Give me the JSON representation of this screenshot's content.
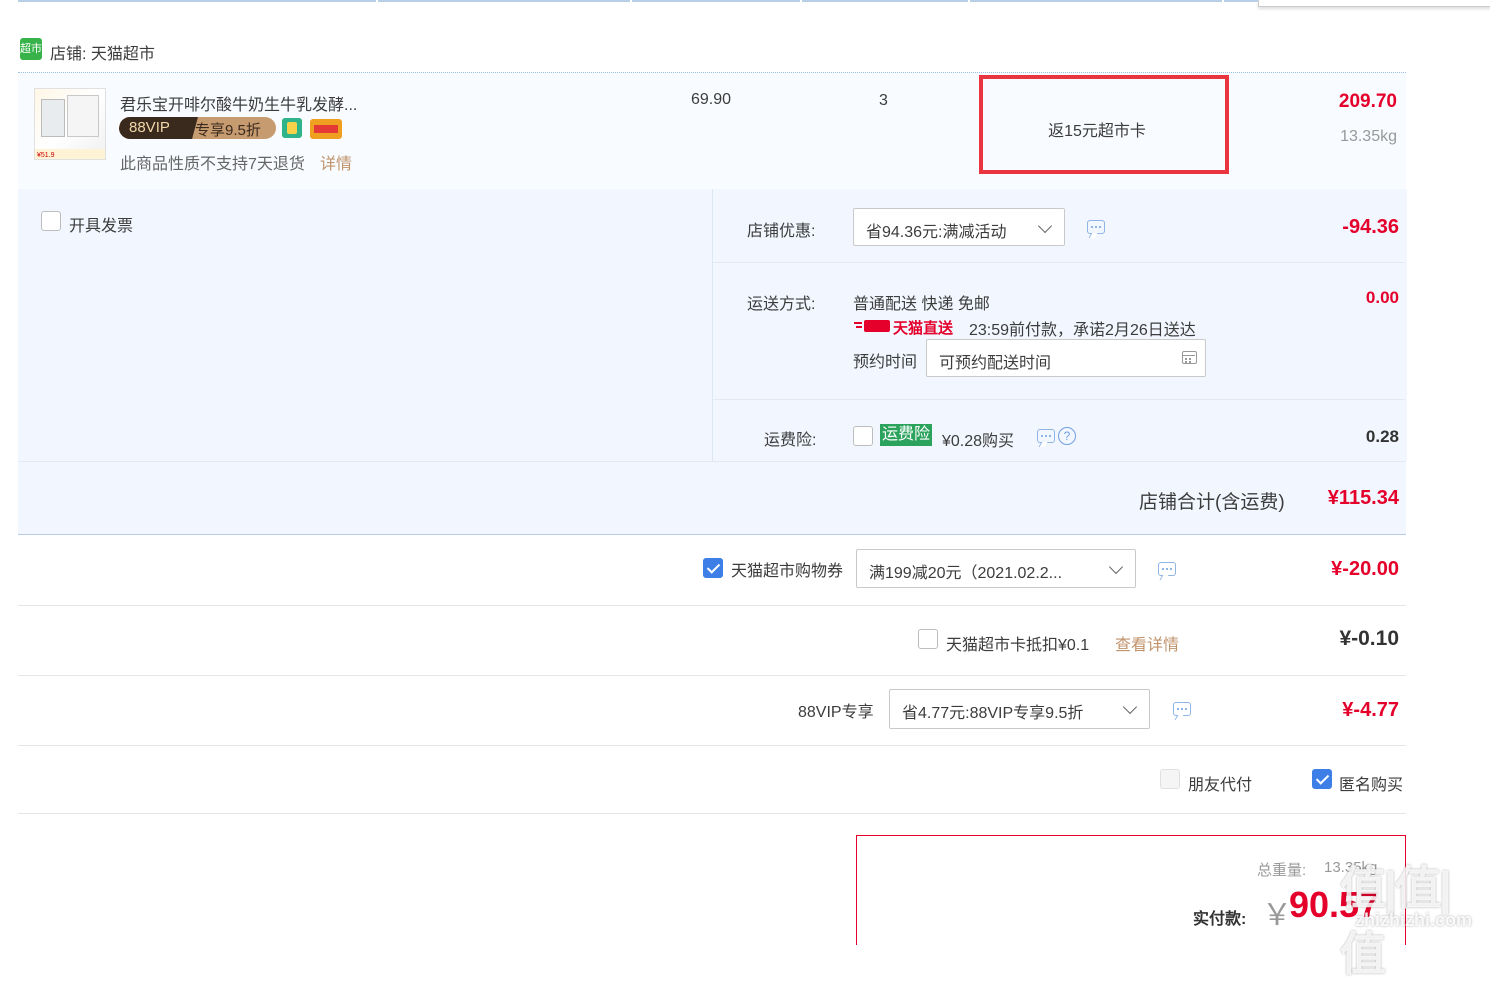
{
  "shop": {
    "label": "店铺: 天猫超市",
    "icon": "tmall-supermarket-icon",
    "icon_text": "超市"
  },
  "item": {
    "title": "君乐宝开啡尔酸牛奶生牛乳发酵...",
    "vip_badge_left": "88VIP",
    "vip_badge_right": "专享9.5折",
    "return_note": "此商品性质不支持7天退货",
    "detail_link": "详情",
    "thumb_price": "¥51.9",
    "price": "69.90",
    "quantity": "3",
    "rebate": "返15元超市卡",
    "subtotal": "209.70",
    "weight": "13.35kg"
  },
  "invoice": {
    "label": "开具发票"
  },
  "store_discount": {
    "label": "店铺优惠:",
    "selected": "省94.36元:满减活动",
    "amount": "-94.36"
  },
  "shipping": {
    "label": "运送方式:",
    "method": "普通配送 快递 免邮",
    "express_brand": "天猫直送",
    "promise": "23:59前付款，承诺2月26日送达",
    "reserve_label": "预约时间",
    "reserve_placeholder": "可预约配送时间",
    "amount": "0.00"
  },
  "insurance": {
    "label": "运费险:",
    "tag": "运费险",
    "price_text": "¥0.28购买",
    "help": "?",
    "amount": "0.28"
  },
  "shop_total": {
    "label": "店铺合计(含运费)",
    "amount": "¥115.34"
  },
  "coupon": {
    "label": "天猫超市购物券",
    "selected": "满199减20元（2021.02.2...",
    "amount": "¥-20.00"
  },
  "card_deduct": {
    "label": "天猫超市卡抵扣¥0.1",
    "link": "查看详情",
    "amount": "¥-0.10"
  },
  "vip88": {
    "label": "88VIP专享",
    "selected": "省4.77元:88VIP专享9.5折",
    "amount": "¥-4.77"
  },
  "options": {
    "friend_pay": "朋友代付",
    "anonymous": "匿名购买"
  },
  "summary": {
    "weight_label": "总重量:",
    "weight_value": "13.35kg",
    "pay_label": "实付款:",
    "currency": "￥",
    "pay_amount": "90.57"
  },
  "watermark": {
    "brand": "值|值|值",
    "url": "zhizhizhi.com"
  },
  "colors": {
    "accent_red": "#e4002b",
    "highlight_box": "#e8353f",
    "panel_bg": "#f2f7ff",
    "link_gold": "#c0936b",
    "check_blue": "#3d7fe6"
  }
}
